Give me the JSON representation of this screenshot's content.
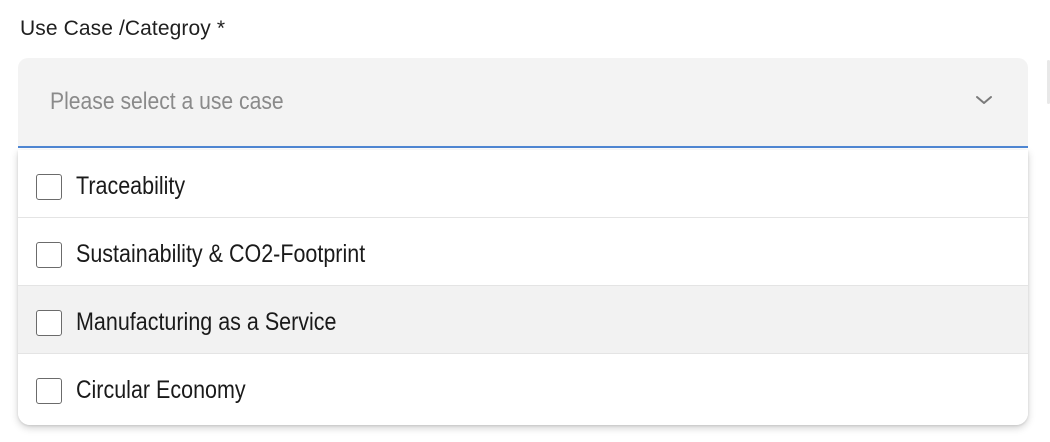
{
  "field": {
    "label": "Use Case /Categroy *",
    "placeholder": "Please select a use case",
    "chevron_icon": "chevron-down-icon"
  },
  "colors": {
    "focus_underline": "#4f87d4",
    "control_bg": "#f3f3f3",
    "hover_row_bg": "#f2f2f2"
  },
  "options": [
    {
      "label": "Traceability",
      "checked": false
    },
    {
      "label": "Sustainability & CO2-Footprint",
      "checked": false
    },
    {
      "label": "Manufacturing as a Service",
      "checked": false,
      "hovered": true
    },
    {
      "label": "Circular Economy",
      "checked": false
    }
  ]
}
